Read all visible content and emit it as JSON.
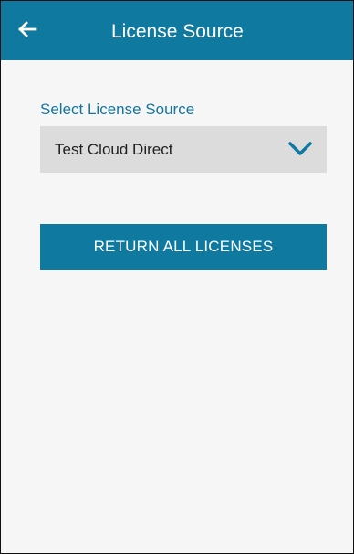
{
  "app_bar": {
    "title": "License Source",
    "back_icon": "arrow-left-icon",
    "background": "#0f79a0"
  },
  "license_source": {
    "label": "Select License Source",
    "selected_value": "Test Cloud Direct",
    "dropdown_icon": "chevron-down-icon"
  },
  "actions": {
    "return_all_label": "RETURN ALL LICENSES"
  },
  "colors": {
    "accent": "#0f79a0",
    "label": "#1476a0",
    "field_background": "#dcdcdc",
    "page_background": "#f6f6f6"
  }
}
